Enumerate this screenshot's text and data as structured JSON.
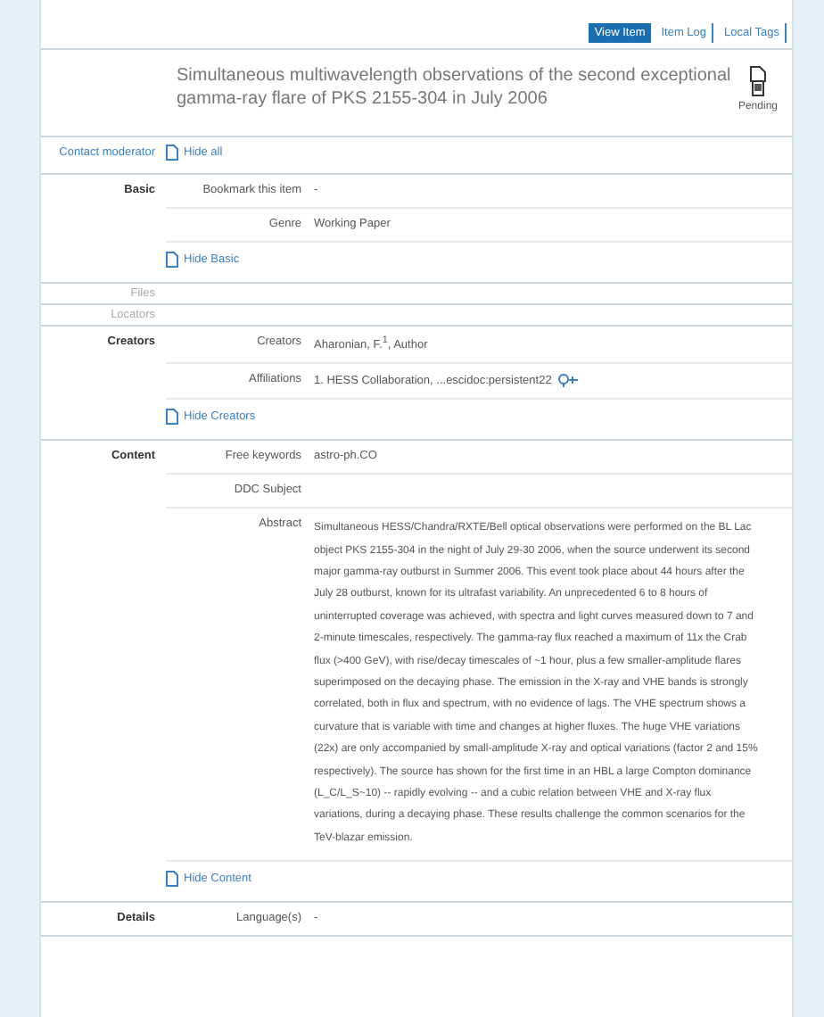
{
  "tabs": [
    {
      "label": "View Item",
      "selected": true
    },
    {
      "label": "Item Log",
      "selected": false
    },
    {
      "label": "Local Tags",
      "selected": false
    }
  ],
  "item": {
    "title": "Simultaneous multiwavelength observations of the second exceptional gamma-ray flare of PKS 2155-304 in July 2006",
    "status": "Pending"
  },
  "contact_moderator": "Contact moderator",
  "hide_all": "Hide all",
  "sections": [
    {
      "label": "Basic",
      "disabled": false,
      "fields": [
        {
          "kind": "text",
          "label": "Bookmark this item",
          "value": "-"
        },
        {
          "kind": "text",
          "label": "Genre",
          "value": "Working Paper"
        }
      ],
      "hide_link": "Hide Basic"
    },
    {
      "label": "Files",
      "disabled": true
    },
    {
      "label": "Locators",
      "disabled": true
    },
    {
      "label": "Creators",
      "disabled": false,
      "fields": [
        {
          "kind": "text",
          "label": "Creators",
          "value": "Aharonian, F.$^{1}$, Author"
        },
        {
          "kind": "affiliation",
          "label": "Affiliations",
          "value": "1. HESS Collaboration, ...escidoc:persistent22"
        }
      ],
      "hide_link": "Hide Creators"
    },
    {
      "label": "Content",
      "disabled": false,
      "fields": [
        {
          "kind": "text",
          "label": "Free keywords",
          "value": "astro-ph.CO"
        },
        {
          "kind": "text",
          "label": "DDC Subject"
        },
        {
          "kind": "long",
          "label": "Abstract",
          "value": "Simultaneous HESS/Chandra/RXTE/Bell optical observations were performed on the BL Lac object PKS 2155-304 in the night of July 29-30 2006, when the source underwent its second major gamma-ray outburst in Summer 2006. This event took place about 44 hours after the July 28 outburst, known for its ultrafast variability. An unprecedented 6 to 8 hours of uninterrupted coverage was achieved, with spectra and light curves measured down to 7 and 2-minute timescales, respectively. The gamma-ray flux reached a maximum of 11x the Crab flux (>400 GeV), with rise/decay timescales of ~1 hour, plus a few smaller-amplitude flares superimposed on the decaying phase. The emission in the X-ray and VHE bands is strongly correlated, both in flux and spectrum, with no evidence of lags. The VHE spectrum shows a curvature that is variable with time and changes at higher fluxes. The huge VHE variations (22x) are only accompanied by small-amplitude X-ray and optical variations (factor 2 and 15% respectively). The source has shown for the first time in an HBL a large Compton dominance (L_C/L_S~10) -- rapidly evolving -- and a cubic relation between VHE and X-ray flux variations, during a decaying phase. These results challenge the common scenarios for the TeV-blazar emission."
        }
      ],
      "hide_link": "Hide Content"
    },
    {
      "label": "Details",
      "disabled": false,
      "fields": [
        {
          "kind": "text",
          "label": "Language(s)",
          "value": "-"
        }
      ]
    }
  ]
}
